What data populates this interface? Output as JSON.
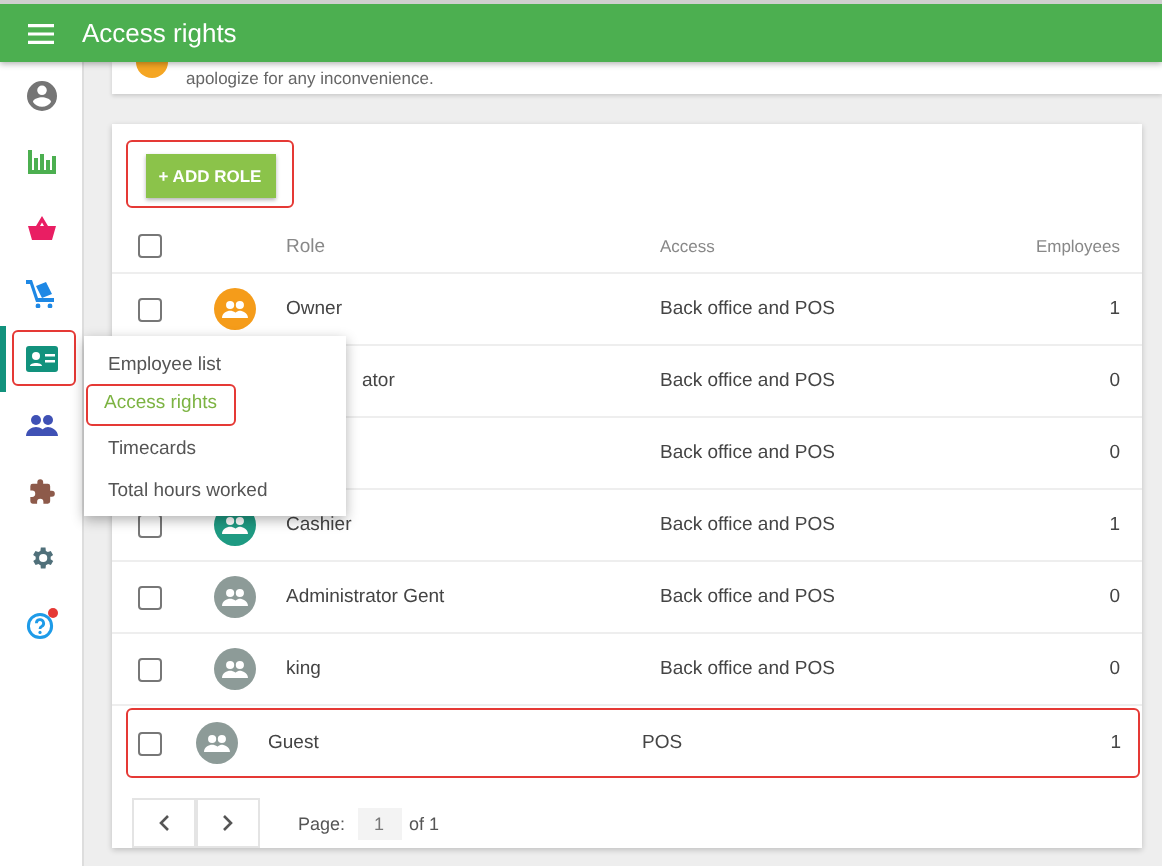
{
  "header": {
    "title": "Access rights"
  },
  "sidebar": {
    "items": [
      {
        "kind": "account",
        "selected": false,
        "highlighted": false,
        "badge": false
      },
      {
        "kind": "chart",
        "selected": false,
        "highlighted": false,
        "badge": false
      },
      {
        "kind": "basket",
        "selected": false,
        "highlighted": false,
        "badge": false
      },
      {
        "kind": "cart",
        "selected": false,
        "highlighted": false,
        "badge": false
      },
      {
        "kind": "card",
        "selected": true,
        "highlighted": true,
        "badge": false
      },
      {
        "kind": "people",
        "selected": false,
        "highlighted": false,
        "badge": false
      },
      {
        "kind": "puzzle",
        "selected": false,
        "highlighted": false,
        "badge": false
      },
      {
        "kind": "gear",
        "selected": false,
        "highlighted": false,
        "badge": false
      },
      {
        "kind": "help",
        "selected": false,
        "highlighted": false,
        "badge": true
      }
    ]
  },
  "notice": {
    "text": "apologize for any inconvenience."
  },
  "add_role_button": {
    "label": "+ ADD ROLE",
    "highlighted": true
  },
  "table": {
    "columns": [
      "Role",
      "Access",
      "Employees"
    ],
    "header_checked": false,
    "rows": [
      {
        "kind": "plain",
        "name": "Owner",
        "access": "Back office and POS",
        "employees": "1",
        "checked": false,
        "color": "#f59c1a",
        "highlighted": false
      },
      {
        "kind": "covered",
        "name": "ator",
        "access": "Back office and POS",
        "employees": "0",
        "highlighted": false
      },
      {
        "kind": "covered",
        "access": "Back office and POS",
        "employees": "0",
        "highlighted": false
      },
      {
        "kind": "plain",
        "name": "Cashier",
        "access": "Back office and POS",
        "employees": "1",
        "checked": false,
        "color": "#1e9a82",
        "highlighted": false
      },
      {
        "kind": "plain",
        "name": "Administrator Gent",
        "access": "Back office and POS",
        "employees": "0",
        "checked": false,
        "color": "#8d9b98",
        "highlighted": false
      },
      {
        "kind": "plain",
        "name": "king",
        "access": "Back office and POS",
        "employees": "0",
        "checked": false,
        "color": "#8d9b98",
        "highlighted": false
      },
      {
        "kind": "plain",
        "name": "Guest",
        "access": "POS",
        "employees": "1",
        "checked": false,
        "color": "#8d9b98",
        "highlighted": true
      }
    ]
  },
  "pagination": {
    "page_label": "Page:",
    "page": "1",
    "total": "of 1"
  },
  "menu": {
    "items": [
      {
        "label": "Employee list",
        "selected": false,
        "highlighted": false
      },
      {
        "label": "Access rights",
        "selected": true,
        "highlighted": true
      },
      {
        "label": "Timecards",
        "selected": false,
        "highlighted": false
      },
      {
        "label": "Total hours worked",
        "selected": false,
        "highlighted": false
      }
    ]
  }
}
